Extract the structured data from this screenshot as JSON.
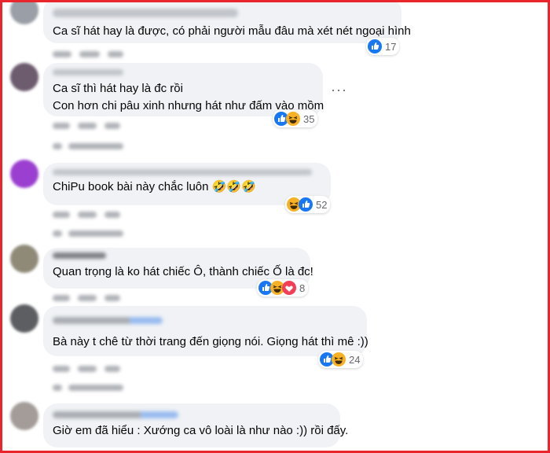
{
  "comments": [
    {
      "text_lines": [
        "Ca sĩ hát hay là được, có phải người mẫu đâu mà xét nét ngoại hình"
      ],
      "reactions": [
        "like"
      ],
      "count": "17"
    },
    {
      "text_lines": [
        "Ca sĩ thì hát hay là đc rồi",
        "Con hơn chi pâu xinh nhưng hát như đấm vào mồm"
      ],
      "reactions": [
        "like",
        "haha"
      ],
      "count": "35"
    },
    {
      "text_lines": [
        "ChiPu book bài này chắc luôn 🤣🤣🤣"
      ],
      "reactions": [
        "haha",
        "like"
      ],
      "count": "52"
    },
    {
      "text_lines": [
        "Quan trọng là ko hát chiếc Ô, thành chiếc Ố là đc!"
      ],
      "reactions": [
        "like",
        "haha",
        "love"
      ],
      "count": "8"
    },
    {
      "text_lines": [
        "Bà này t chê từ thời trang đến giọng nói. Giọng hát thì mê :))"
      ],
      "reactions": [
        "like",
        "haha"
      ],
      "count": "24"
    },
    {
      "text_lines": [
        "Giờ em đã hiểu : Xướng ca vô loài là như nào :)) rồi đấy."
      ],
      "reactions": [],
      "count": ""
    }
  ],
  "more_options": "···",
  "colors": {
    "frame": "#e8262b",
    "bubble": "#f0f2f5",
    "like": "#1877f2",
    "haha": "#f7b125",
    "love": "#f33e58"
  }
}
